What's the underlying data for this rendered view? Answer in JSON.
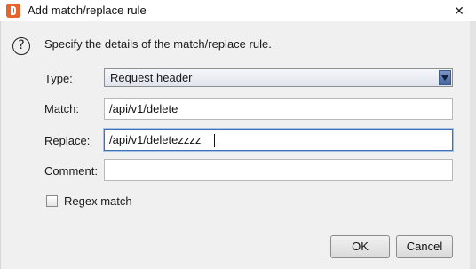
{
  "window": {
    "title": "Add match/replace rule",
    "close_glyph": "✕"
  },
  "dialog": {
    "help_glyph": "?",
    "description": "Specify the details of the match/replace rule.",
    "type": {
      "label": "Type:",
      "value": "Request header"
    },
    "match": {
      "label": "Match:",
      "value": "/api/v1/delete"
    },
    "replace": {
      "label": "Replace:",
      "value": "/api/v1/deletezzzz"
    },
    "comment": {
      "label": "Comment:",
      "value": ""
    },
    "regex": {
      "label": "Regex match",
      "checked": false
    },
    "ok_label": "OK",
    "cancel_label": "Cancel"
  },
  "colors": {
    "app_icon": "#e8632b",
    "focus_border": "#3f6fb4",
    "dialog_bg": "#f0f0f0"
  }
}
